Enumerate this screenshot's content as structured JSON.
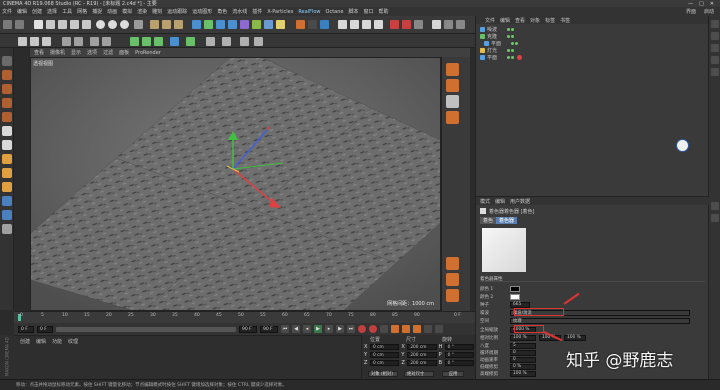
{
  "app": {
    "title": "CINEMA 4D R19.068 Studio (RC - R19) - [未标题 2.c4d *] - 主要",
    "window_controls": [
      "—",
      "□",
      "✕"
    ]
  },
  "menubar": {
    "items": [
      "文件",
      "编辑",
      "创建",
      "选择",
      "工具",
      "网格",
      "捕捉",
      "动画",
      "模拟",
      "渲染",
      "雕刻",
      "运动跟踪",
      "运动图形",
      "角色",
      "流水线",
      "插件",
      "X-Particles",
      "RealFlow",
      "Octane",
      "脚本",
      "窗口",
      "帮助"
    ],
    "highlighted": "RealFlow",
    "right": [
      "界面",
      "启动"
    ]
  },
  "viewport": {
    "menu": [
      "查看",
      "摄像机",
      "显示",
      "选项",
      "过滤",
      "面板",
      "ProRender"
    ],
    "label": "透视视图",
    "grid_distance": "网格间距：1000 cm"
  },
  "timeline": {
    "ticks": [
      "0",
      "5",
      "10",
      "15",
      "20",
      "25",
      "30",
      "35",
      "40",
      "45",
      "50",
      "55",
      "60",
      "65",
      "70",
      "75",
      "80",
      "85",
      "90"
    ],
    "frame_indicator": "0 F"
  },
  "playbar": {
    "start": "0 F",
    "current": "0 F",
    "end": "90 F",
    "end2": "90 F"
  },
  "material_manager": {
    "menu": [
      "创建",
      "编辑",
      "功能",
      "纹理"
    ]
  },
  "coordinates": {
    "headers": [
      "位置",
      "尺寸",
      "旋转"
    ],
    "rows": [
      {
        "pos": "0 cm",
        "axis_p": "X",
        "size": "200 cm",
        "axis_s": "X",
        "rot": "0 °",
        "axis_r": "H"
      },
      {
        "pos": "0 cm",
        "axis_p": "Y",
        "size": "200 cm",
        "axis_s": "Y",
        "rot": "0 °",
        "axis_r": "P"
      },
      {
        "pos": "0 cm",
        "axis_p": "Z",
        "size": "200 cm",
        "axis_s": "Z",
        "rot": "0 °",
        "axis_r": "B"
      }
    ],
    "mode_select": "对象 (相对)",
    "size_select": "绝对尺寸",
    "apply": "应用"
  },
  "object_manager": {
    "menu": [
      "文件",
      "编辑",
      "查看",
      "对象",
      "标签",
      "书签"
    ],
    "objects": [
      {
        "name": "噪波",
        "color": "#5aa0e0"
      },
      {
        "name": "克隆",
        "color": "#6ac06a"
      },
      {
        "name": "平面",
        "color": "#5aa0e0"
      },
      {
        "name": "灯光",
        "color": "#e0c050"
      },
      {
        "name": "平面",
        "color": "#5aa0e0"
      }
    ]
  },
  "attribute_manager": {
    "menu": [
      "模式",
      "编辑",
      "用户数据"
    ],
    "shader_title": "着色器着色器 [着色]",
    "tabs": [
      "着色",
      "着色器"
    ],
    "section": "着色器属性",
    "fields": [
      {
        "label": "颜色 1",
        "value": ""
      },
      {
        "label": "颜色 2",
        "value": ""
      },
      {
        "label": "种子",
        "value": "665"
      },
      {
        "label": "噪波",
        "value": "噪波/湍流"
      },
      {
        "label": "空间",
        "value": "纹理"
      },
      {
        "label": "全局缩放",
        "value": "4000 %"
      },
      {
        "label": "相对比例",
        "value": "100 %"
      },
      {
        "label": "八度",
        "value": "5"
      },
      {
        "label": "循环周期",
        "value": "0"
      },
      {
        "label": "动画速率",
        "value": "0"
      },
      {
        "label": "低端修剪",
        "value": "0 %"
      },
      {
        "label": "高端修剪",
        "value": "100 %"
      },
      {
        "label": "亮度",
        "value": "0 %"
      },
      {
        "label": "对比",
        "value": "0 %"
      },
      {
        "label": "使用绝对比例 (采样)",
        "value": ""
      }
    ],
    "relative_scale_extra": [
      "100 %",
      "100 %"
    ]
  },
  "status": "移动：点击并拖动鼠标移动元素。按住 SHIFT 键量化移动；节点编辑模式时按住 SHIFT 键增加选择对象；按住 CTRL 键减少选择对象。",
  "brand": "MAXON CINEMA 4D",
  "watermark": "知乎 @野鹿志",
  "colors": {
    "highlight_red": "#e03333",
    "x_axis": "#e04040",
    "y_axis": "#40c040",
    "z_axis": "#4060e0"
  }
}
